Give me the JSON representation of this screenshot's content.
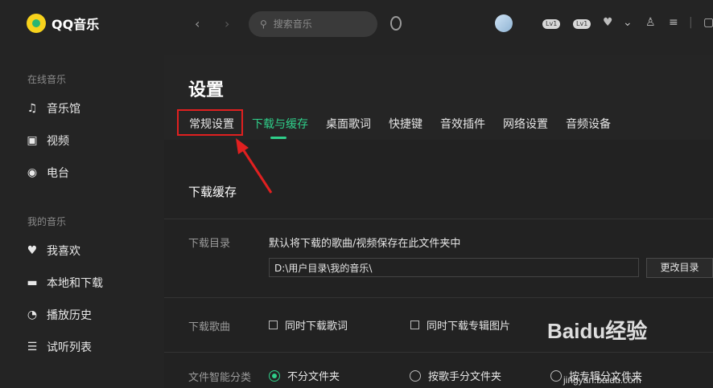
{
  "app": {
    "name": "QQ音乐"
  },
  "sidebar": {
    "online_section": "在线音乐",
    "my_section": "我的音乐",
    "items": [
      {
        "label": "音乐馆",
        "icon": "music-note-icon"
      },
      {
        "label": "视频",
        "icon": "video-icon"
      },
      {
        "label": "电台",
        "icon": "radio-icon"
      },
      {
        "label": "我喜欢",
        "icon": "heart-icon"
      },
      {
        "label": "本地和下载",
        "icon": "monitor-icon"
      },
      {
        "label": "播放历史",
        "icon": "clock-icon"
      },
      {
        "label": "试听列表",
        "icon": "playlist-icon"
      }
    ]
  },
  "topbar": {
    "search_placeholder": "搜索音乐",
    "badges": [
      "Lv1",
      "Lv1"
    ]
  },
  "settings": {
    "title": "设置",
    "tabs": [
      "常规设置",
      "下载与缓存",
      "桌面歌词",
      "快捷键",
      "音效插件",
      "网络设置",
      "音频设备"
    ],
    "active_tab": "下载与缓存",
    "section_title": "下载缓存",
    "download_dir": {
      "label": "下载目录",
      "desc": "默认将下载的歌曲/视频保存在此文件夹中",
      "path": "D:\\用户目录\\我的音乐\\",
      "change_button": "更改目录"
    },
    "download_song": {
      "label": "下载歌曲",
      "options": [
        "同时下载歌词",
        "同时下载专辑图片"
      ]
    },
    "smart_sort": {
      "label": "文件智能分类",
      "options": [
        "不分文件夹",
        "按歌手分文件夹",
        "按专辑分文件夹"
      ],
      "selected": "不分文件夹"
    }
  },
  "watermark": {
    "text": "Baidu经验",
    "sub": "jingyan.baidu.com"
  },
  "colors": {
    "accent": "#2fcf8a",
    "highlight": "#e02020"
  }
}
